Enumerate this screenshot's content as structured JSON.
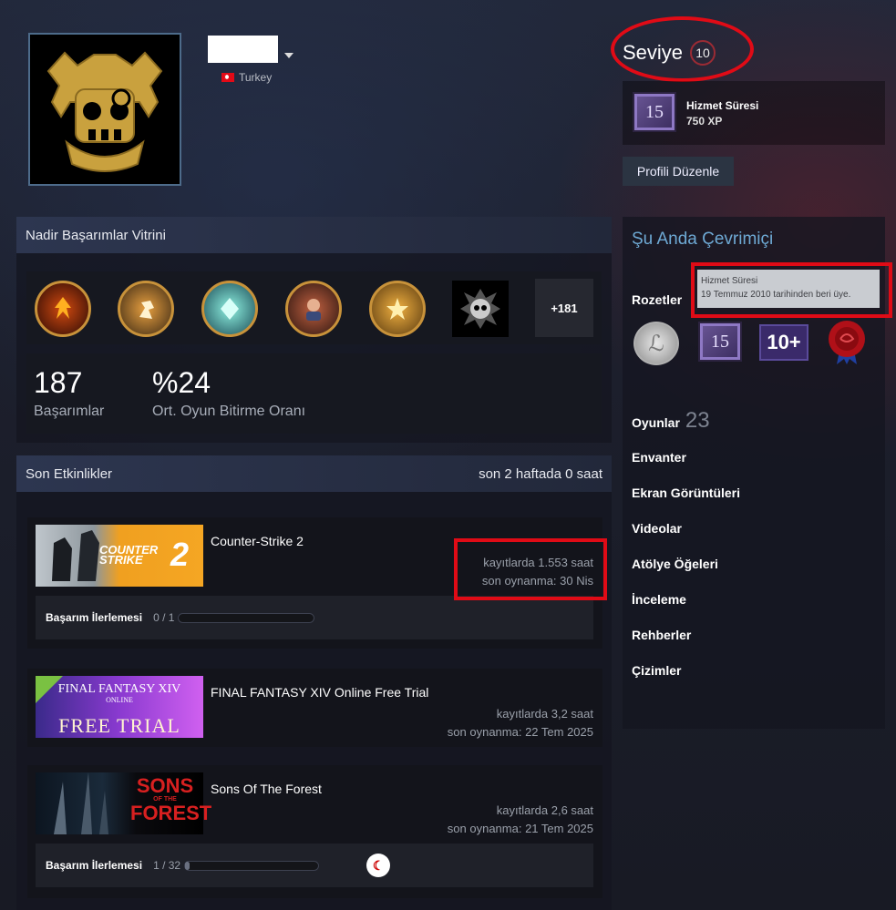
{
  "profile": {
    "country": "Turkey"
  },
  "level": {
    "label": "Seviye",
    "value": "10"
  },
  "featured_badge": {
    "number": "15",
    "title": "Hizmet Süresi",
    "xp": "750 XP"
  },
  "edit_profile": "Profili Düzenle",
  "showcase": {
    "title": "Nadir Başarımlar Vitrini",
    "more": "+181",
    "achievements_count": "187",
    "achievements_label": "Başarımlar",
    "completion": "%24",
    "completion_label": "Ort. Oyun Bitirme Oranı"
  },
  "recent": {
    "title": "Son Etkinlikler",
    "summary": "son 2 haftada 0 saat",
    "games": [
      {
        "name": "Counter-Strike 2",
        "hours": "kayıtlarda 1.553 saat",
        "last_played": "son oynanma: 30 Nis",
        "progress_label": "Başarım İlerlemesi",
        "progress_count": "0 / 1",
        "progress": 0
      },
      {
        "name": "FINAL FANTASY XIV Online Free Trial",
        "hours": "kayıtlarda 3,2 saat",
        "last_played": "son oynanma: 22 Tem 2025"
      },
      {
        "name": "Sons Of The Forest",
        "hours": "kayıtlarda 2,6 saat",
        "last_played": "son oynanma: 21 Tem 2025",
        "progress_label": "Başarım İlerlemesi",
        "progress_count": "1 / 32",
        "progress": 0.03125
      }
    ]
  },
  "sidebar": {
    "online": "Şu Anda Çevrimiçi",
    "badges_label": "Rozetler",
    "tooltip_title": "Hizmet Süresi",
    "tooltip_text": "19 Temmuz 2010 tarihinden beri üye.",
    "badge_15": "15",
    "badge_10plus": "10+",
    "games_label": "Oyunlar",
    "games_count": "23",
    "links": [
      "Envanter",
      "Ekran Görüntüleri",
      "Videolar",
      "Atölye Öğeleri",
      "İnceleme",
      "Rehberler",
      "Çizimler"
    ]
  },
  "game_art": {
    "cs2_line1": "COUNTER",
    "cs2_line2": "STRIKE",
    "cs2_num": "2",
    "ff_line1": "FINAL FANTASY XIV",
    "ff_line2": "ONLINE",
    "ff_line3": "FREE TRIAL",
    "sotf_line1": "SONS",
    "sotf_line2": "FOREST",
    "sotf_small": "OF THE"
  }
}
